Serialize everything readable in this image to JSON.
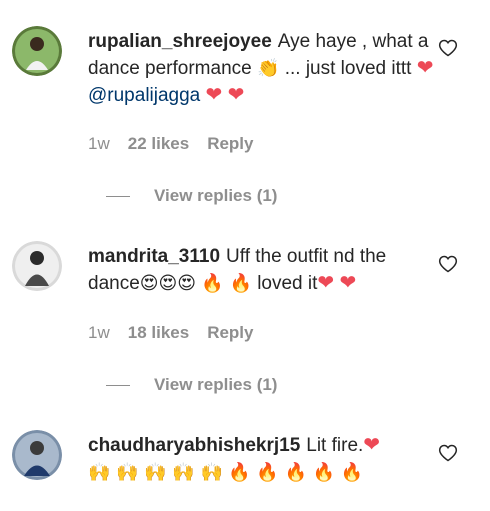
{
  "comments": [
    {
      "username": "rupalian_shreejoyee",
      "text_parts": {
        "a": "Aye haye , what a dance performance",
        "b": "... just loved ittt",
        "mention": "@rupalijagga"
      },
      "emojis": {
        "clap": "👏",
        "heart": "❤",
        "heart2": "❤",
        "heart3": "❤"
      },
      "time": "1w",
      "likes": "22 likes",
      "reply": "Reply",
      "view_replies": "View replies (1)"
    },
    {
      "username": "mandrita_3110",
      "text_parts": {
        "a": "Uff the outfit nd the dance",
        "b": "loved it"
      },
      "emojis": {
        "heart_eyes": "😍😍😍",
        "fire": "🔥 🔥",
        "heart": "❤",
        "heart2": "❤"
      },
      "time": "1w",
      "likes": "18 likes",
      "reply": "Reply",
      "view_replies": "View replies (1)"
    },
    {
      "username": "chaudharyabhishekrj15",
      "text_parts": {
        "a": "Lit fire."
      },
      "emojis": {
        "heart": "❤",
        "raised_hands": "🙌 🙌 🙌 🙌 🙌",
        "fire": "🔥 🔥 🔥 🔥 🔥"
      }
    }
  ],
  "colors": {
    "text": "#262626",
    "muted": "#8e8e8e",
    "mention": "#00376b",
    "heart": "#ed4956"
  },
  "icons": {
    "like": "heart-outline-icon"
  }
}
